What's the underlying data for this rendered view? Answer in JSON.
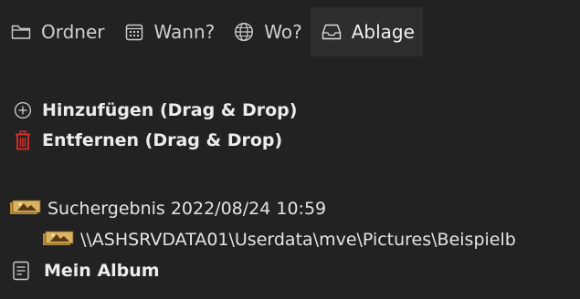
{
  "tabs": [
    {
      "label": "Ordner",
      "icon": "folder-icon",
      "active": false
    },
    {
      "label": "Wann?",
      "icon": "calendar-icon",
      "active": false
    },
    {
      "label": "Wo?",
      "icon": "globe-icon",
      "active": false
    },
    {
      "label": "Ablage",
      "icon": "tray-icon",
      "active": true
    }
  ],
  "actions": {
    "add_label": "Hinzufügen (Drag & Drop)",
    "add_icon": "plus-circle-icon",
    "remove_label": "Entfernen (Drag & Drop)",
    "remove_icon": "trash-icon",
    "remove_icon_color": "#d9302c"
  },
  "tree": {
    "search_result": {
      "label": "Suchergebnis 2022/08/24 10:59",
      "icon": "photo-stack-icon"
    },
    "search_path": {
      "label": "\\\\ASHSRVDATA01\\Userdata\\mve\\Pictures\\Beispielb",
      "icon": "photo-stack-icon"
    },
    "album": {
      "label": "Mein Album",
      "icon": "album-icon"
    }
  },
  "colors": {
    "background": "#222222",
    "active_tab": "#2e2e2e",
    "text": "#e4e4e4",
    "photo_icon_gold": "#c89b3c"
  }
}
